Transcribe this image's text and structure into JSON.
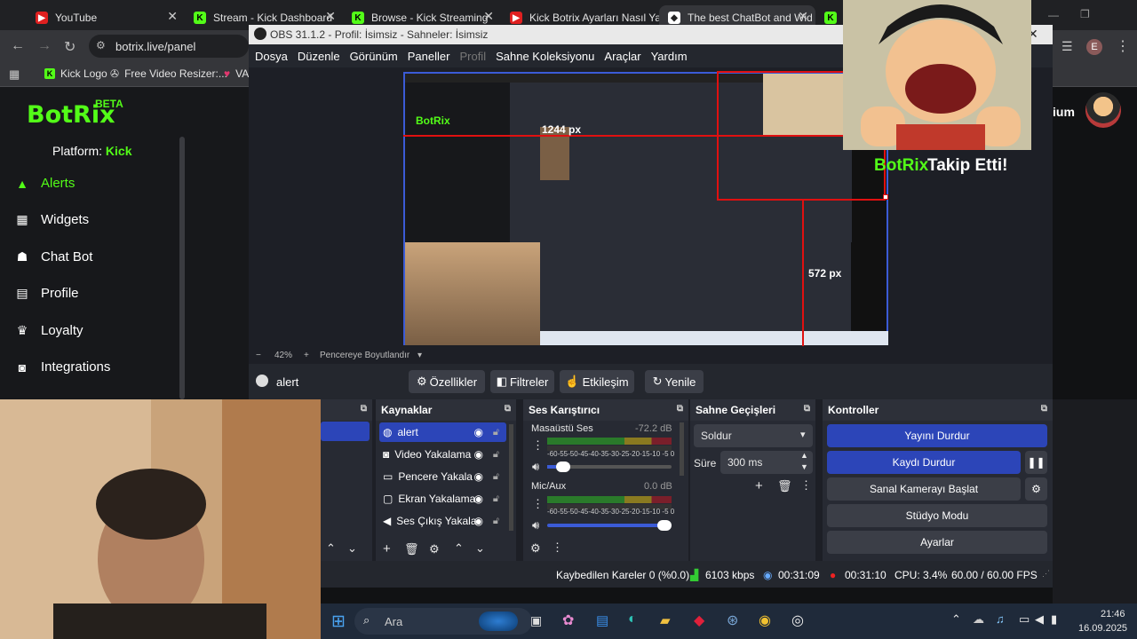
{
  "browser": {
    "tabs": [
      {
        "label": "YouTube",
        "icon": "youtube-icon",
        "active": false
      },
      {
        "label": "Stream - Kick Dashboard",
        "icon": "kick-icon",
        "active": false
      },
      {
        "label": "Browse - Kick Streaming",
        "icon": "kick-icon",
        "active": false
      },
      {
        "label": "Kick Botrix Ayarları Nasıl Ya",
        "icon": "youtube-icon",
        "active": false
      },
      {
        "label": "The best ChatBot and Wid",
        "icon": "botrix-icon",
        "active": true
      }
    ],
    "url": "botrix.live/panel",
    "profile_initial": "E",
    "bookmarks": [
      {
        "label": "Kick Logo",
        "icon": "kick-icon"
      },
      {
        "label": "Free Video Resizer:...",
        "icon": "resizer-icon"
      },
      {
        "label": "VA",
        "icon": "va-icon"
      }
    ]
  },
  "botrix": {
    "logo": "BotRix",
    "badge": "BETA",
    "platform_label": "Platform:",
    "platform_value": "Kick",
    "nav": [
      {
        "label": "Alerts",
        "icon": "alert-triangle-icon",
        "active": true
      },
      {
        "label": "Widgets",
        "icon": "grid-icon",
        "active": false
      },
      {
        "label": "Chat Bot",
        "icon": "robot-icon",
        "active": false
      },
      {
        "label": "Profile",
        "icon": "id-card-icon",
        "active": false
      },
      {
        "label": "Loyalty",
        "icon": "trophy-icon",
        "active": false
      },
      {
        "label": "Integrations",
        "icon": "integrations-icon",
        "active": false
      }
    ],
    "premium_label": "ium"
  },
  "obs": {
    "title": "OBS 31.1.2 - Profil: İsimsiz - Sahneler: İsimsiz",
    "menu": [
      "Dosya",
      "Düzenle",
      "Görünüm",
      "Paneller",
      "Profil",
      "Sahne Koleksiyonu",
      "Araçlar",
      "Yardım"
    ],
    "preview": {
      "width_label": "1244 px",
      "height_label": "572 px",
      "overlay_text_1": "BotRix",
      "overlay_text_2": "Takip Etti!"
    },
    "zoom": {
      "minus": "−",
      "value": "42%",
      "plus": "+",
      "fit": "Pencereye Boyutlandır",
      "arrow": "▾"
    },
    "selected_source": "alert",
    "source_buttons": [
      "Özellikler",
      "Filtreler",
      "Etkileşim",
      "Yenile"
    ],
    "sources": {
      "title": "Kaynaklar",
      "items": [
        "alert",
        "Video Yakalama",
        "Pencere Yakala",
        "Ekran Yakalama",
        "Ses Çıkış Yakala"
      ]
    },
    "mixer": {
      "title": "Ses Karıştırıcı",
      "channels": [
        {
          "name": "Masaüstü Ses",
          "db": "-72.2 dB",
          "level": 0.08
        },
        {
          "name": "Mic/Aux",
          "db": "0.0 dB",
          "level": 0.95
        }
      ],
      "scale": "-60-55-50-45-40-35-30-25-20-15-10 -5  0"
    },
    "transitions": {
      "title": "Sahne Geçişleri",
      "selected": "Soldur",
      "duration_label": "Süre",
      "duration_value": "300 ms"
    },
    "controls": {
      "title": "Kontroller",
      "buttons": [
        "Yayını Durdur",
        "Kaydı Durdur",
        "Sanal Kamerayı Başlat",
        "Stüdyo Modu",
        "Ayarlar"
      ]
    },
    "status": {
      "dropped": "Kaybedilen Kareler 0 (%0.0)",
      "bitrate": "6103 kbps",
      "stream_time": "00:31:09",
      "rec_time": "00:31:10",
      "cpu": "CPU: 3.4%",
      "fps": "60.00 / 60.00 FPS"
    }
  },
  "taskbar": {
    "search_placeholder": "Ara",
    "time": "21:46",
    "date": "16.09.2025"
  }
}
